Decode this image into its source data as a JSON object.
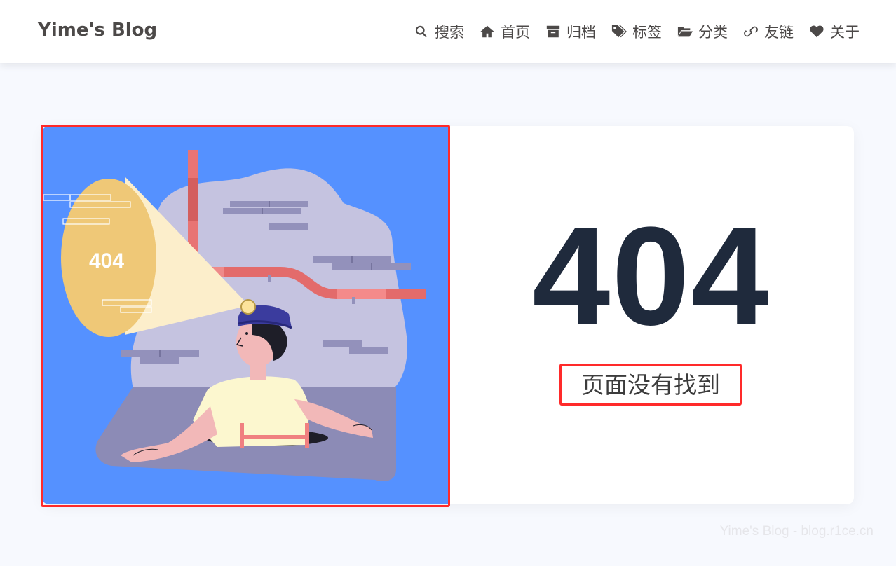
{
  "site": {
    "brand": "Yime's Blog"
  },
  "nav": {
    "items": [
      {
        "label": "搜索",
        "icon": "search-icon"
      },
      {
        "label": "首页",
        "icon": "home-icon"
      },
      {
        "label": "归档",
        "icon": "archive-icon"
      },
      {
        "label": "标签",
        "icon": "tags-icon"
      },
      {
        "label": "分类",
        "icon": "folder-open-icon"
      },
      {
        "label": "友链",
        "icon": "link-icon"
      },
      {
        "label": "关于",
        "icon": "heart-icon"
      }
    ]
  },
  "error": {
    "code": "404",
    "message": "页面没有找到",
    "illustration_label": "404"
  },
  "footer": {
    "watermark": "Yime's Blog - blog.r1ce.cn"
  },
  "colors": {
    "nav_text": "#4c4948",
    "illustration_bg": "#5591ff",
    "error_code": "#1f2a3c",
    "highlight_frame": "#ff2a2a"
  }
}
